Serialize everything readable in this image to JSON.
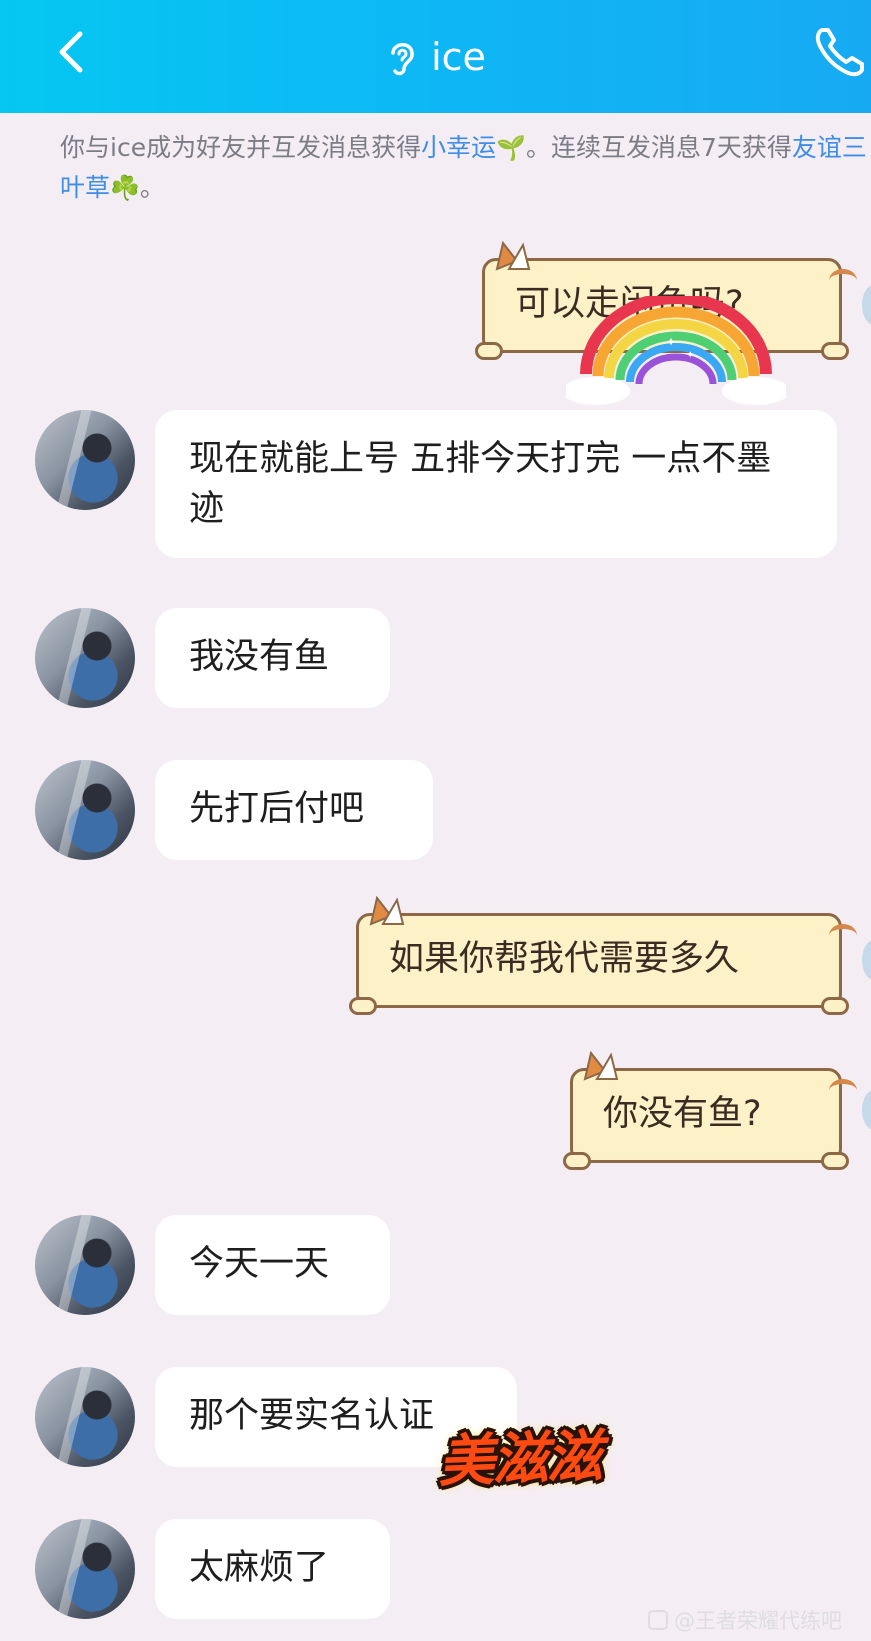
{
  "header": {
    "title": "ice",
    "background": "#10b4f5",
    "back_icon": "chevron-left-icon",
    "ear_icon": "ear-icon",
    "call_icon": "phone-icon"
  },
  "notice": {
    "part1": "你与ice成为好友并互发消息获得",
    "link1": "小幸运",
    "emoji1": "🌱",
    "part2": "。连续互发消息7天获得",
    "link2": "友谊三叶草",
    "emoji2": "☘️",
    "part3": "。",
    "link_color": "#3e8de8"
  },
  "messages": [
    {
      "side": "out",
      "text": "可以走闲鱼吗?"
    },
    {
      "side": "in",
      "text": "现在就能上号 五排今天打完 一点不墨迹"
    },
    {
      "side": "in",
      "text": "我没有鱼"
    },
    {
      "side": "in",
      "text": "先打后付吧"
    },
    {
      "side": "out",
      "text": "如果你帮我代需要多久"
    },
    {
      "side": "out",
      "text": "你没有鱼?"
    },
    {
      "side": "in",
      "text": "今天一天"
    },
    {
      "side": "in",
      "text": "那个要实名认证"
    },
    {
      "side": "in",
      "text": "太麻烦了"
    }
  ],
  "sticker": {
    "text": "美滋滋",
    "icon": "rainbow-sticker-icon"
  },
  "watermark": {
    "text": "@王者荣耀代练吧"
  }
}
